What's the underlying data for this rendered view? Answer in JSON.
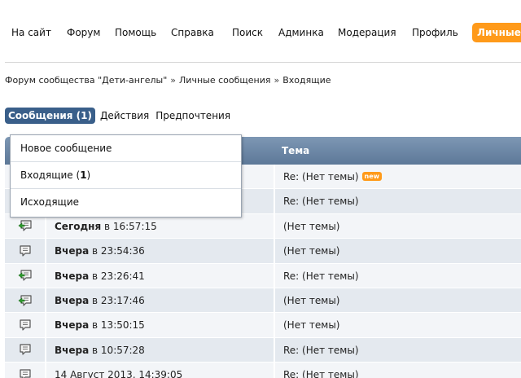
{
  "topmenu": {
    "items": [
      {
        "label": "На сайт"
      },
      {
        "label": "Форум"
      },
      {
        "label": "Помощь"
      },
      {
        "label": "Справка"
      },
      {
        "label": "Поиск"
      },
      {
        "label": "Админка"
      },
      {
        "label": "Модерация"
      },
      {
        "label": "Профиль"
      },
      {
        "label": "Личные"
      }
    ]
  },
  "breadcrumb": {
    "items": [
      "Форум сообщества \"Дети-ангелы\"",
      "Личные сообщения",
      "Входящие"
    ],
    "separator": "»"
  },
  "subtabs": {
    "messages": "Сообщения (1)",
    "actions": "Действия",
    "preferences": "Предпочтения"
  },
  "dropdown": {
    "new_message": "Новое сообщение",
    "inbox_label": "Входящие",
    "inbox_count_open": " (",
    "inbox_count": "1",
    "inbox_count_close": ")",
    "outbox": "Исходящие"
  },
  "table": {
    "subject_header": "Тема",
    "new_badge": "new",
    "rows": [
      {
        "icon": "reply-message-icon",
        "date_bold": "",
        "date_rest": "",
        "subject": "Re: (Нет темы)",
        "is_new": true
      },
      {
        "icon": "message-icon",
        "date_bold": "",
        "date_rest": "",
        "subject": "Re: (Нет темы)",
        "is_new": false
      },
      {
        "icon": "reply-message-icon",
        "date_bold": "Сегодня",
        "date_rest": " в 16:57:15",
        "subject": "(Нет темы)",
        "is_new": false
      },
      {
        "icon": "message-icon",
        "date_bold": "Вчера",
        "date_rest": " в 23:54:36",
        "subject": "(Нет темы)",
        "is_new": false
      },
      {
        "icon": "reply-message-icon",
        "date_bold": "Вчера",
        "date_rest": " в 23:26:41",
        "subject": "Re: (Нет темы)",
        "is_new": false
      },
      {
        "icon": "reply-message-icon",
        "date_bold": "Вчера",
        "date_rest": " в 23:17:46",
        "subject": "(Нет темы)",
        "is_new": false
      },
      {
        "icon": "message-icon",
        "date_bold": "Вчера",
        "date_rest": " в 13:50:15",
        "subject": "(Нет темы)",
        "is_new": false
      },
      {
        "icon": "message-icon",
        "date_bold": "Вчера",
        "date_rest": " в 10:57:28",
        "subject": "Re: (Нет темы)",
        "is_new": false
      },
      {
        "icon": "message-icon",
        "date_bold": "",
        "date_rest": "14 Август 2013, 14:39:05",
        "subject": "Re: (Нет темы)",
        "is_new": false
      }
    ]
  },
  "colors": {
    "accent_orange": "#ff9a1a",
    "tab_blue": "#3a5f8a",
    "header_blue": "#6a84a3",
    "row_light": "#f3f5f8",
    "row_dark": "#e4e9ef"
  }
}
